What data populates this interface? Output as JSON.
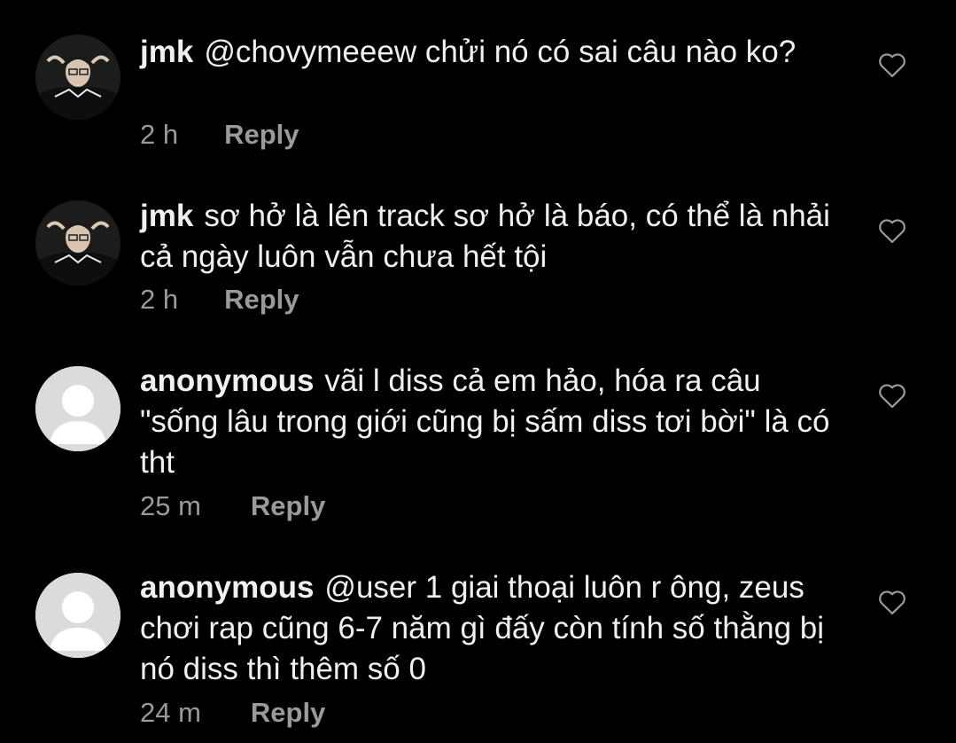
{
  "comments": [
    {
      "username": "jmk",
      "text": "@chovymeeew chửi nó có sai câu nào ko?",
      "time": "2 h",
      "reply_label": "Reply",
      "avatar": "photo"
    },
    {
      "username": "jmk",
      "text": "sơ hở là lên track sơ hở là báo, có thể là nhải cả ngày luôn vẫn chưa hết tội",
      "time": "2 h",
      "reply_label": "Reply",
      "avatar": "photo"
    },
    {
      "username": "anonymous",
      "text": "vãi l diss cả em hảo, hóa ra câu \"sống lâu trong giới cũng bị sấm diss tơi bời\" là có tht",
      "time": "25 m",
      "reply_label": "Reply",
      "avatar": "default"
    },
    {
      "username": "anonymous",
      "text": "@user 1 giai thoại luôn r ông, zeus chơi rap cũng 6-7 năm gì đấy còn tính số thằng bị nó diss thì thêm số 0",
      "time": "24 m",
      "reply_label": "Reply",
      "avatar": "default"
    }
  ],
  "icons": {
    "like": "heart-outline-icon",
    "default_avatar": "user-silhouette-icon"
  },
  "colors": {
    "background": "#000000",
    "text": "#f0f0f0",
    "meta": "#9a9a9a",
    "default_avatar_bg": "#dbdbdb",
    "default_avatar_fg": "#ffffff"
  }
}
